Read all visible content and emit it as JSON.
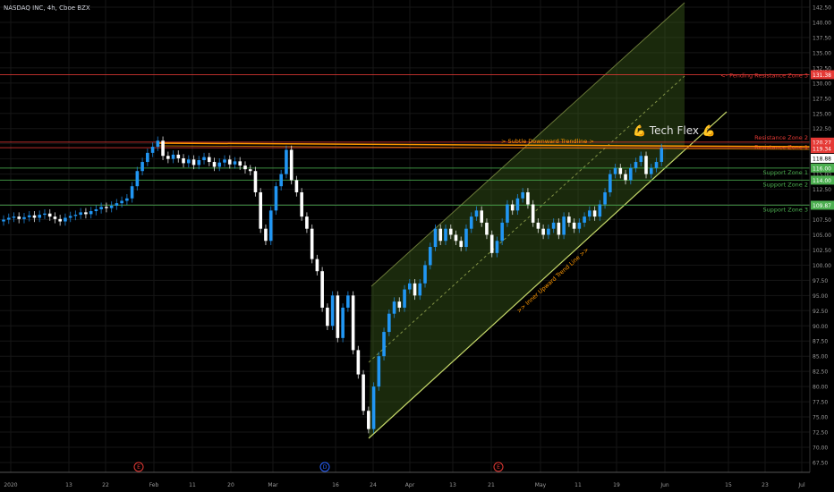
{
  "header": {
    "title": "NASDAQ INC, 4h, Cboe BZX"
  },
  "annotation": {
    "tech_flex": "Tech Flex",
    "emoji": "💪"
  },
  "chart_data": {
    "type": "candlestick",
    "title": "NASDAQ INC, 4h, Cboe BZX",
    "ylim": [
      67.5,
      142.5
    ],
    "y_ticks": [
      "142.50",
      "140.00",
      "137.50",
      "135.00",
      "132.50",
      "130.00",
      "127.50",
      "125.00",
      "122.50",
      "120.00",
      "117.50",
      "115.00",
      "112.50",
      "110.00",
      "107.50",
      "105.00",
      "102.50",
      "100.00",
      "97.50",
      "95.00",
      "92.50",
      "90.00",
      "87.50",
      "85.00",
      "82.50",
      "80.00",
      "77.50",
      "75.00",
      "72.50",
      "70.00",
      "67.50"
    ],
    "x_ticks": [
      "2020",
      "13",
      "22",
      "Feb",
      "11",
      "20",
      "Mar",
      "16",
      "24",
      "Apr",
      "13",
      "21",
      "May",
      "11",
      "19",
      "Jun",
      "15",
      "23",
      "Jul"
    ],
    "colors": {
      "up": "#2196f3",
      "down": "#ffffff",
      "resistance": "#e53935",
      "support": "#4caf50",
      "trend": "#ff9800",
      "channel": "#c6d96a"
    },
    "closes": [
      107.5,
      107.8,
      108,
      107.6,
      107.9,
      108.2,
      107.8,
      108.3,
      108.5,
      108,
      107.6,
      107.2,
      107.8,
      108.1,
      108.3,
      108.7,
      108.4,
      108.9,
      109.2,
      109.6,
      109.4,
      109.8,
      110.2,
      110.6,
      111,
      113,
      115.5,
      117,
      118.5,
      119.5,
      120.5,
      118,
      117.5,
      118.2,
      117.6,
      116.8,
      117.4,
      116.5,
      117.3,
      117.8,
      117,
      116.2,
      116.9,
      117.4,
      116.6,
      117.1,
      116.4,
      115.8,
      115.5,
      112,
      106,
      104,
      109,
      113,
      115,
      119,
      114,
      112,
      108,
      106,
      101,
      99,
      93,
      90,
      95,
      88,
      93,
      95,
      86,
      82,
      76,
      73,
      80,
      85,
      89,
      92,
      94,
      93,
      96,
      97,
      95,
      97,
      100,
      103,
      106,
      104,
      106,
      105,
      104,
      103,
      106,
      108,
      109,
      107,
      105,
      102,
      104,
      107,
      110,
      109,
      111,
      112,
      110,
      107,
      106,
      105,
      106,
      107,
      105,
      108,
      107,
      106,
      107,
      108,
      109,
      108,
      110,
      112,
      115,
      116,
      115,
      114,
      116,
      117,
      118,
      115,
      116,
      117,
      119.3
    ],
    "levels": [
      {
        "name": "<- Pending Resistance Zone 3",
        "price": 131.38,
        "label": "131.38",
        "kind": "resistance"
      },
      {
        "name": "Resistance Zone 2",
        "price": 120.27,
        "label": "120.27",
        "kind": "resistance"
      },
      {
        "name": "Resistance Zone 1",
        "price": 119.34,
        "label": "119.34",
        "kind": "resistance"
      },
      {
        "name": "Support Zone 1",
        "price": 116.0,
        "label": "116.00",
        "kind": "support"
      },
      {
        "name": "Support Zone 2",
        "price": 114.0,
        "label": "114.00",
        "kind": "support"
      },
      {
        "name": "Support Zone 3",
        "price": 109.87,
        "label": "109.87",
        "kind": "support"
      }
    ],
    "last_price": {
      "price": 118.88,
      "label": "118.88"
    },
    "trendlines": {
      "downward": "> Subtle Downward Trendline >",
      "upward": ">> Inner Upward Trend Line >>"
    },
    "events": [
      {
        "label": "E",
        "type": "earnings"
      },
      {
        "label": "D",
        "type": "dividend"
      },
      {
        "label": "E",
        "type": "earnings"
      }
    ]
  }
}
